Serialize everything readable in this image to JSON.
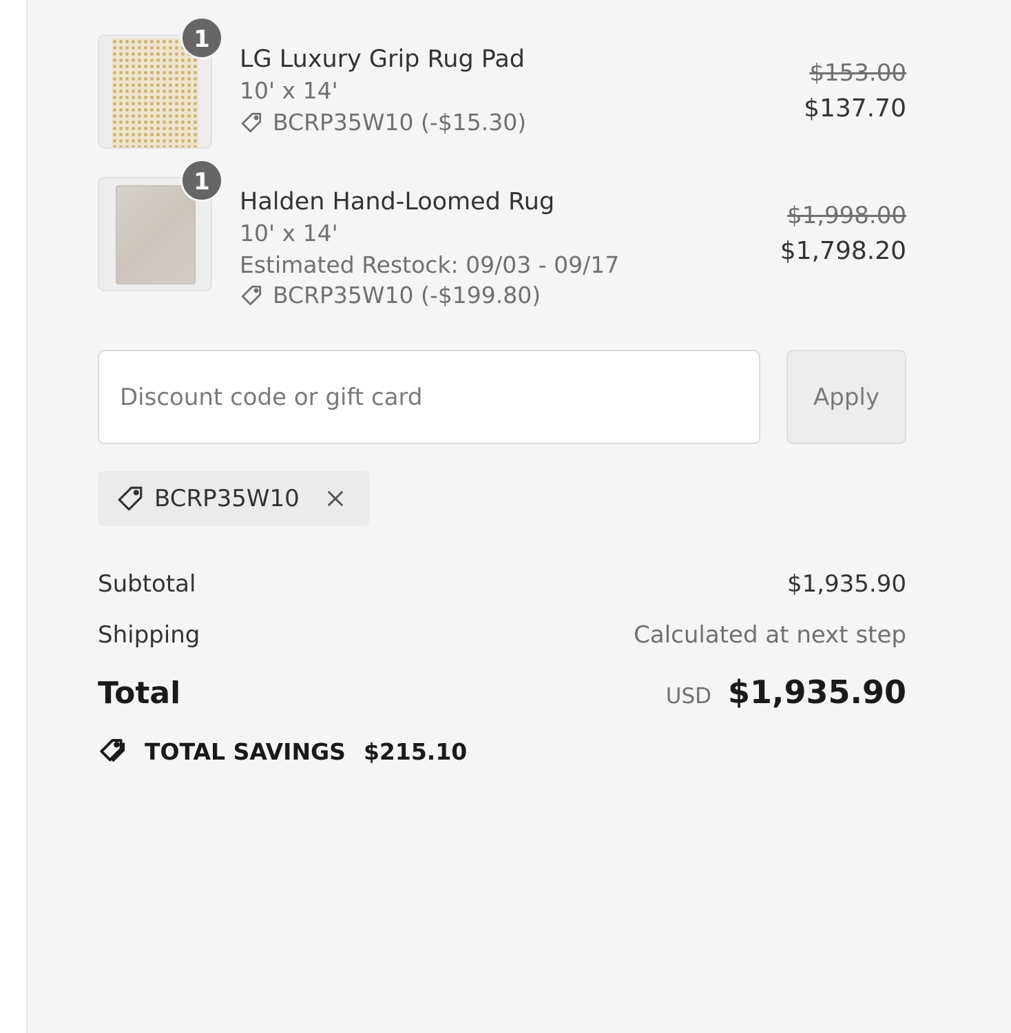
{
  "items": [
    {
      "quantity": "1",
      "name": "LG Luxury Grip Rug Pad",
      "size": "10' x 14'",
      "restock": "",
      "discount": "BCRP35W10 (-$15.30)",
      "original_price": "$153.00",
      "final_price": "$137.70",
      "image_icon": "rug-pad-thumbnail"
    },
    {
      "quantity": "1",
      "name": "Halden Hand-Loomed Rug",
      "size": "10' x 14'",
      "restock": "Estimated Restock: 09/03 - 09/17",
      "discount": "BCRP35W10 (-$199.80)",
      "original_price": "$1,998.00",
      "final_price": "$1,798.20",
      "image_icon": "rug-thumbnail"
    }
  ],
  "discount": {
    "placeholder": "Discount code or gift card",
    "value": "",
    "apply_label": "Apply",
    "applied_code": "BCRP35W10"
  },
  "summary": {
    "subtotal_label": "Subtotal",
    "subtotal_value": "$1,935.90",
    "shipping_label": "Shipping",
    "shipping_value": "Calculated at next step",
    "total_label": "Total",
    "currency": "USD",
    "total_value": "$1,935.90",
    "savings_label": "TOTAL SAVINGS",
    "savings_value": "$215.10"
  },
  "icons": {
    "tag": "tag-icon",
    "remove": "close-icon",
    "savings": "tags-icon"
  },
  "colors": {
    "panel_background": "#f5f5f5",
    "badge": "#666666",
    "text_primary": "#333333",
    "text_muted": "#707070"
  }
}
